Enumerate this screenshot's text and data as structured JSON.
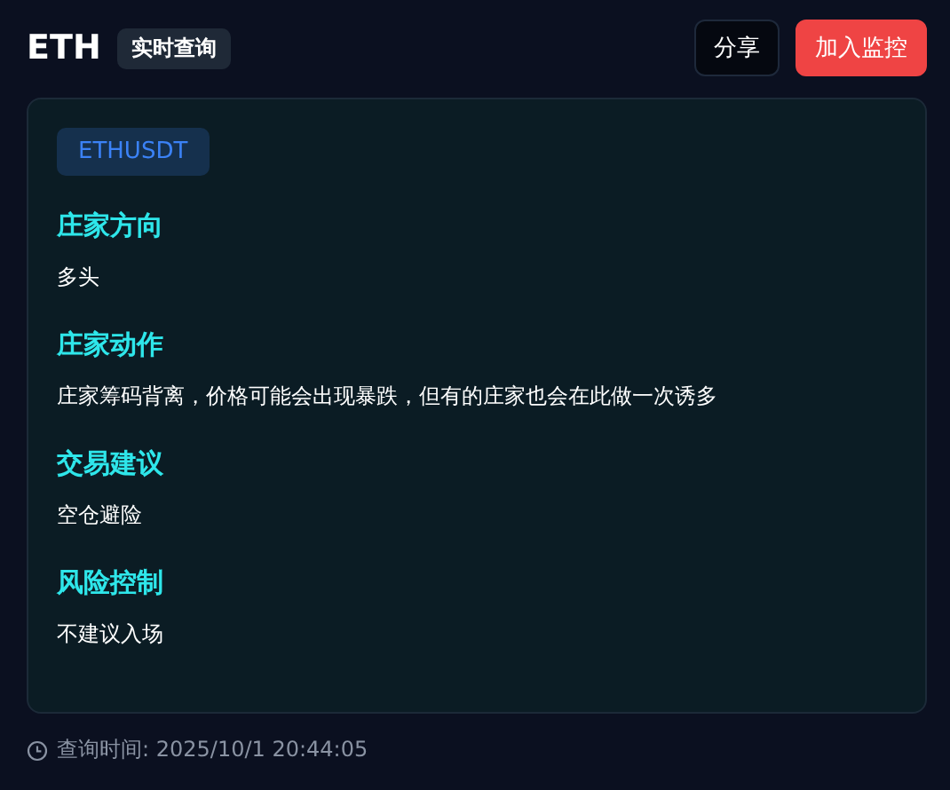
{
  "header": {
    "title": "ETH",
    "badge": "实时查询",
    "buttons": [
      {
        "label": "分享",
        "kind": "secondary"
      },
      {
        "label": "加入监控",
        "kind": "primary"
      }
    ]
  },
  "card": {
    "symbol": "ETHUSDT",
    "sections": [
      {
        "heading": "庄家方向",
        "text": "多头"
      },
      {
        "heading": "庄家动作",
        "text": "庄家筹码背离，价格可能会出现暴跌，但有的庄家也会在此做一次诱多"
      },
      {
        "heading": "交易建议",
        "text": "空仓避险"
      },
      {
        "heading": "风险控制",
        "text": "不建议入场"
      }
    ]
  },
  "footer": {
    "query_time": "查询时间: 2025/10/1 20:44:05"
  }
}
